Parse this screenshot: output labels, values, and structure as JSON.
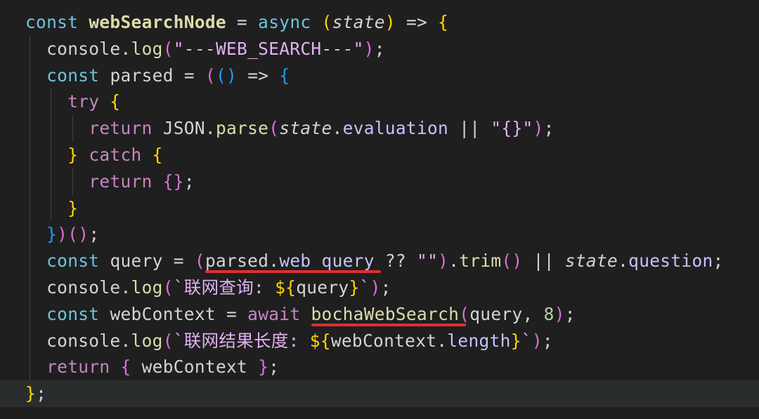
{
  "code": {
    "language": "javascript",
    "lines": [
      "const webSearchNode = async (state) => {",
      "  console.log(\"---WEB_SEARCH---\");",
      "  const parsed = (() => {",
      "    try {",
      "      return JSON.parse(state.evaluation || \"{}\");",
      "    } catch {",
      "      return {};",
      "    }",
      "  })();",
      "  const query = (parsed.web_query ?? \"\").trim() || state.question;",
      "  console.log(`联网查询: ${query}`);",
      "  const webContext = await bochaWebSearch(query, 8);",
      "  console.log(`联网结果长度: ${webContext.length}`);",
      "  return { webContext };",
      "};"
    ],
    "highlighted_tokens": [
      "parsed.web_query",
      "bochaWebSearch"
    ],
    "highlight_color": "#e0302f",
    "active_line": 15
  }
}
